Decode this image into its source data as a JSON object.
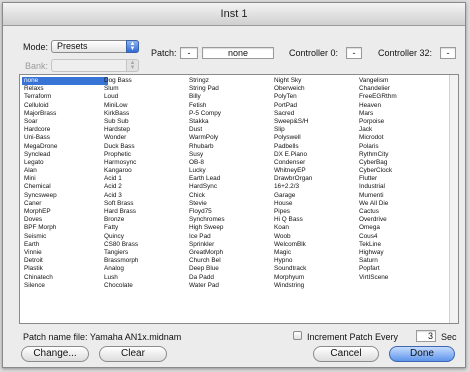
{
  "window": {
    "title": "Inst 1"
  },
  "mode": {
    "label": "Mode:",
    "value": "Presets"
  },
  "bank": {
    "label": "Bank:",
    "value": ""
  },
  "patch": {
    "label": "Patch:",
    "number": "-",
    "name": "none"
  },
  "controller0": {
    "label": "Controller 0:",
    "value": "-"
  },
  "controller32": {
    "label": "Controller 32:",
    "value": "-"
  },
  "patch_list": {
    "selected": "none",
    "columns": [
      [
        "none",
        "Relaxs",
        "Terraform",
        "Celluloid",
        "MajorBrass",
        "Soar",
        "Hardcore",
        "Uni-Bass",
        "MegaDrone",
        "Synclead",
        "Legato",
        "Alan",
        "Mini",
        "Chemical",
        "Syncsweep",
        "Caner",
        "MorphEP",
        "Doves",
        "BPF Morph",
        "Seismic",
        "Earth",
        "Vinnie",
        "Detroit",
        "Plastik",
        "Chinatech",
        "Silence"
      ],
      [
        "Dog Bass",
        "Slum",
        "Loud",
        "MiniLow",
        "KirkBass",
        "Sub Sub",
        "Hardstep",
        "Wonder",
        "Duck Bass",
        "Prophetic",
        "Harmosync",
        "Kangaroo",
        "Acid 1",
        "Acid 2",
        "Acid 3",
        "Soft Brass",
        "Hard Brass",
        "Bronze",
        "Fatty",
        "Quincy",
        "CS80 Brass",
        "Tangiers",
        "Brassmorph",
        "Analog",
        "Lush",
        "Chocolate"
      ],
      [
        "Stringz",
        "String Pad",
        "Billy",
        "Fetish",
        "P-5 Compy",
        "Stakka",
        "Dust",
        "WarmPoly",
        "Rhubarb",
        "Susy",
        "OB-8",
        "Lucky",
        "Earth Lead",
        "HardSync",
        "Chick",
        "Stevie",
        "Floyd75",
        "Synchromes",
        "High Sweep",
        "Ice Pad",
        "Sprinkler",
        "GreatMorph",
        "Church Bel",
        "Deep Blue",
        "Da Padd",
        "Water Pad"
      ],
      [
        "Night Sky",
        "Oberweich",
        "PolyTen",
        "PortPad",
        "Sacred",
        "Sweep&S/H",
        "Slip",
        "Polyswell",
        "Padbells",
        "DX E.Piano",
        "Condenser",
        "WhitneyEP",
        "DrawbrOrgan",
        "16+2.2/3",
        "Garage",
        "House",
        "Pipes",
        "Hi Q Bass",
        "Koan",
        "Woob",
        "WelcomBlk",
        "Magic",
        "Hypno",
        "Soundtrack",
        "Morphyum",
        "Windstring"
      ],
      [
        "Vangelism",
        "Chandelier",
        "FreeEGRthm",
        "Heaven",
        "Mars",
        "Porpoise",
        "Jack",
        "Microdot",
        "Polaris",
        "RythmCity",
        "CyberBag",
        "CyberClock",
        "Flutter",
        "Industrial",
        "Mumenti",
        "We All Die",
        "Cactus",
        "Overdrive",
        "Omega",
        "Cous4",
        "TekLine",
        "Highway",
        "Saturn",
        "Popfart",
        "VirtIScene",
        ""
      ]
    ]
  },
  "footer": {
    "patch_file_label": "Patch name file: Yamaha AN1x.midnam",
    "increment_label": "Increment Patch Every",
    "increment_value": "3",
    "increment_unit": "Sec",
    "increment_checked": false
  },
  "buttons": {
    "change": "Change...",
    "clear": "Clear",
    "cancel": "Cancel",
    "done": "Done"
  }
}
